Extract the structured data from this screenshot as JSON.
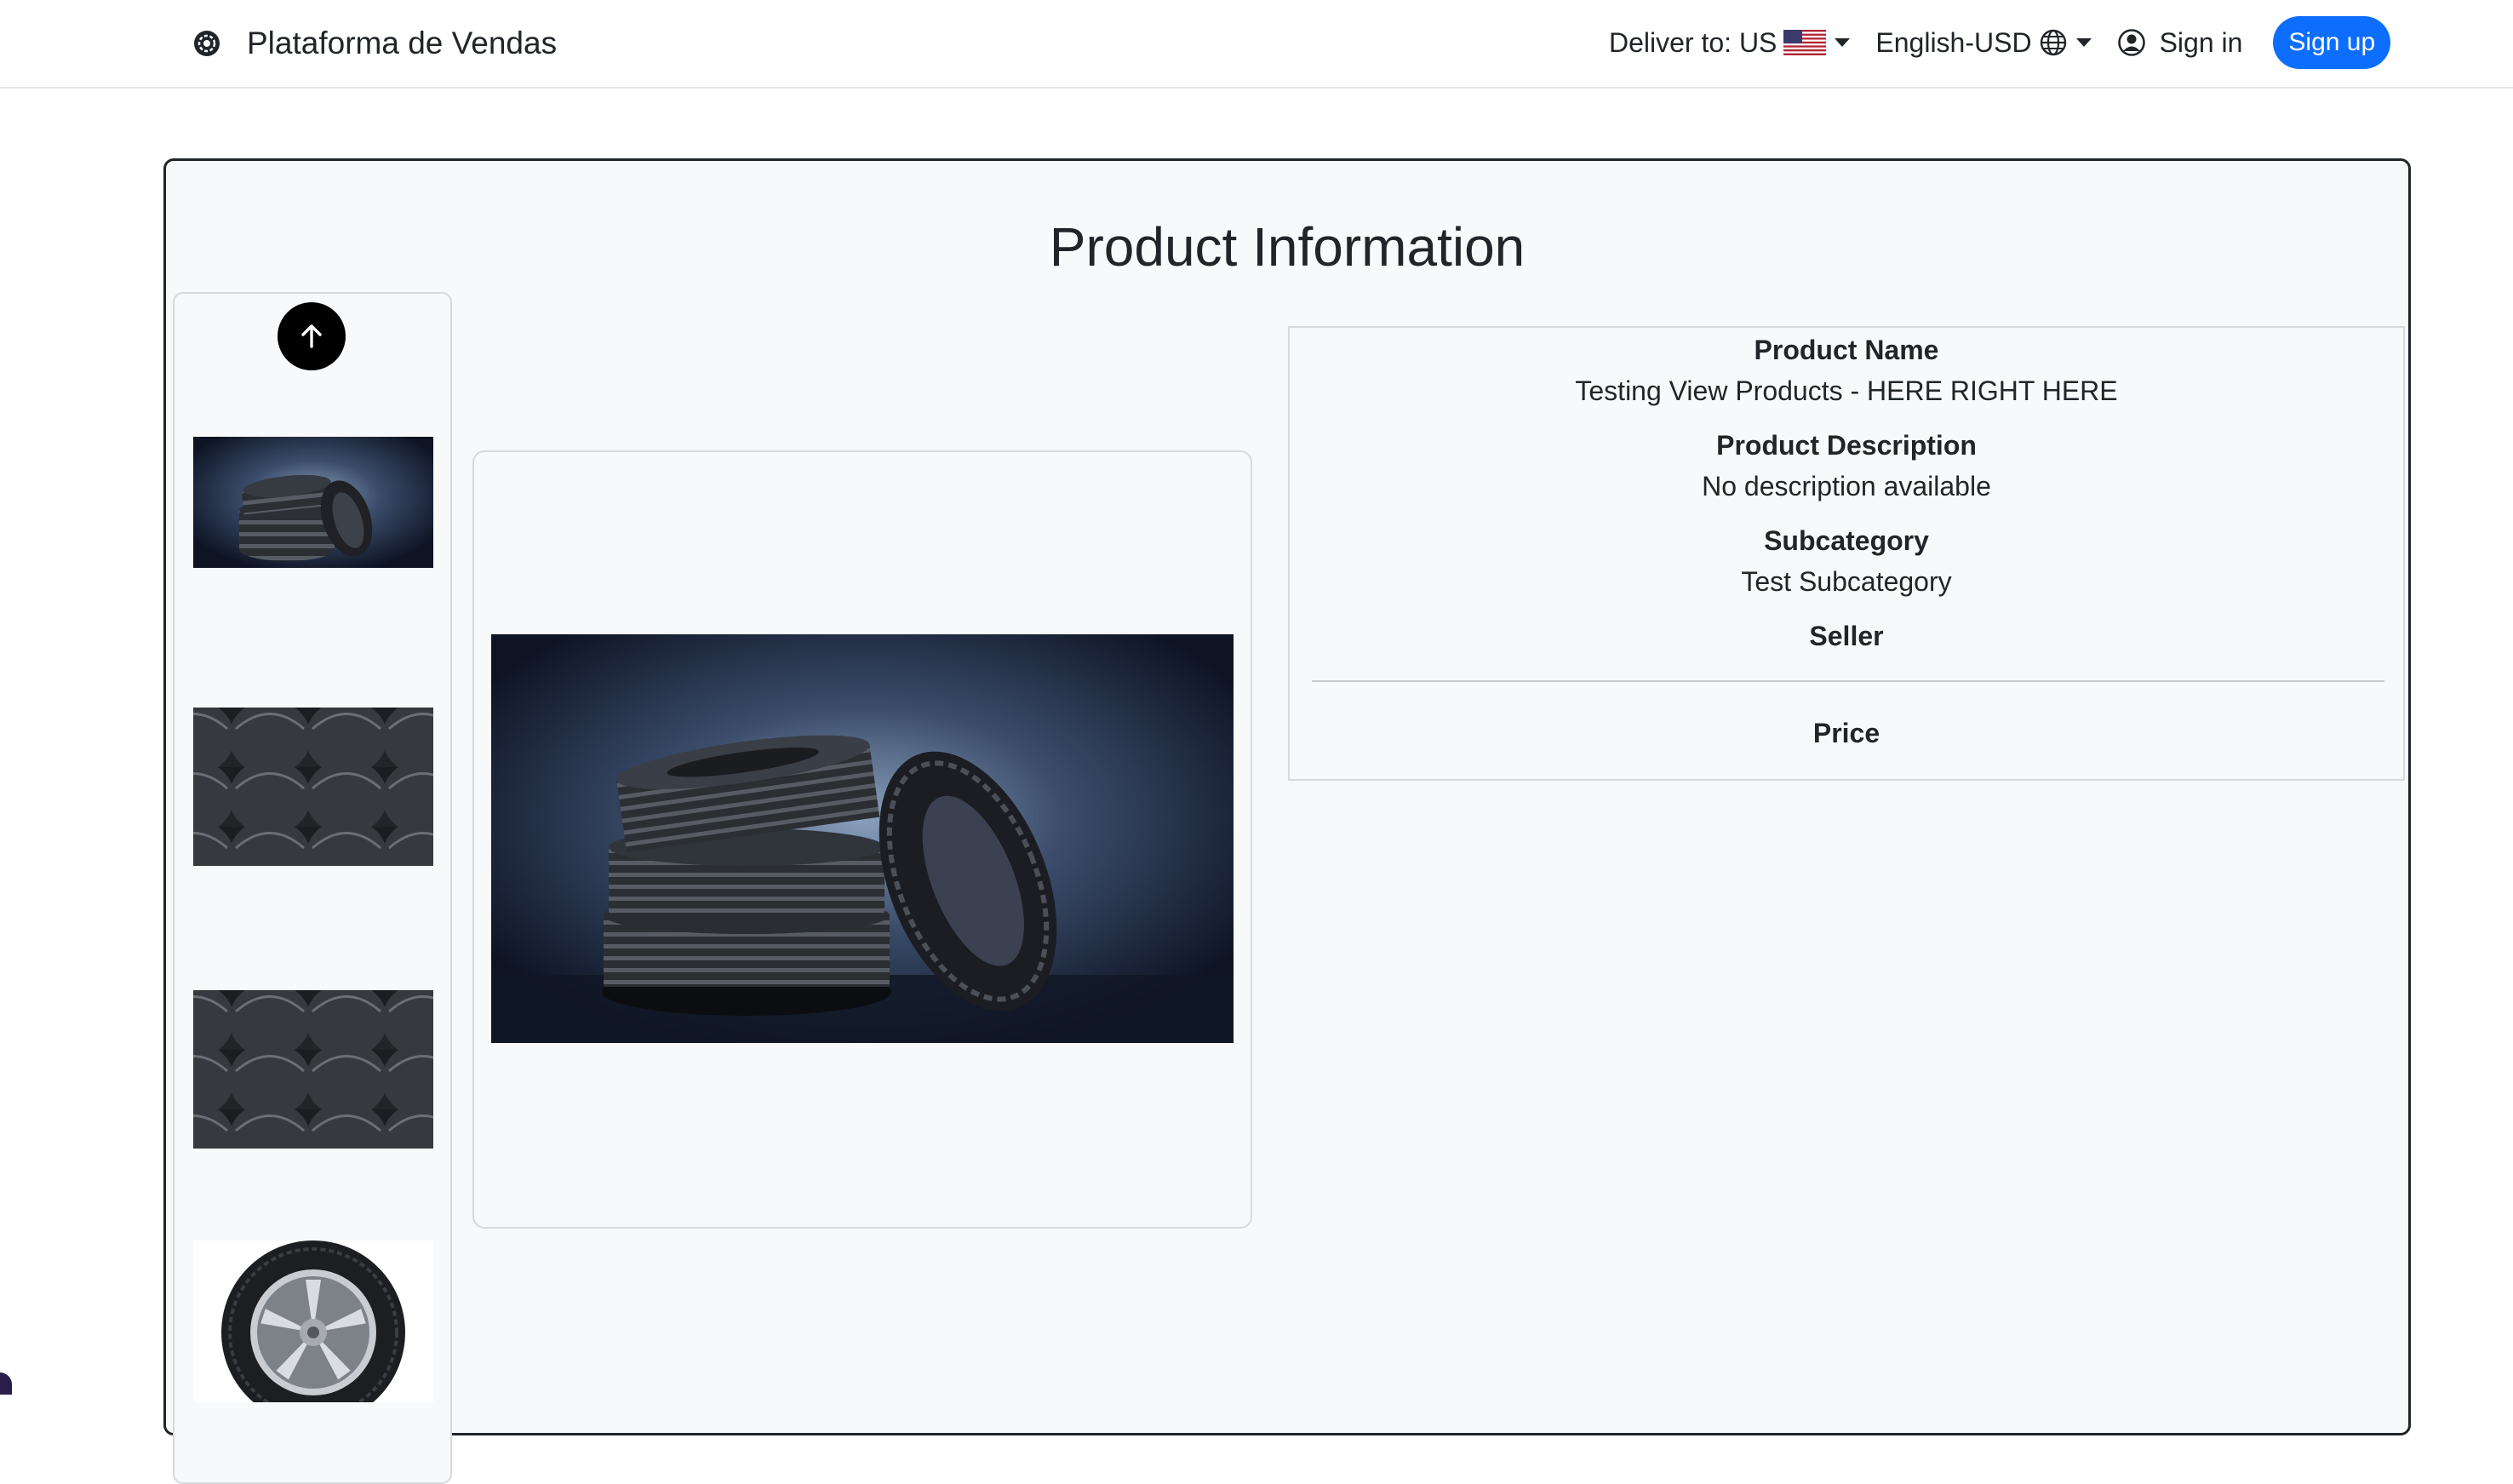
{
  "navbar": {
    "brand": "Plataforma de Vendas",
    "brand_icon": "gear-logo-icon",
    "deliver_label": "Deliver to: US",
    "flag_icon": "us-flag-icon",
    "language_label": "English-USD",
    "language_icon": "globe-icon",
    "signin_label": "Sign in",
    "signin_icon": "user-circle-icon",
    "signup_label": "Sign up",
    "accent_color": "#0d6efd"
  },
  "page": {
    "title": "Product Information"
  },
  "gallery": {
    "scroll_up_icon": "arrow-up-icon",
    "thumbnails": [
      {
        "name": "tire-stack-thumbnail"
      },
      {
        "name": "tire-pile-thumbnail"
      },
      {
        "name": "tire-pile-thumbnail"
      },
      {
        "name": "wheel-rim-thumbnail"
      }
    ],
    "main_image": "tire-stack-main-image"
  },
  "product": {
    "name_label": "Product Name",
    "name_value": "Testing View Products - HERE RIGHT HERE",
    "description_label": "Product Description",
    "description_value": "No description available",
    "subcategory_label": "Subcategory",
    "subcategory_value": "Test Subcategory",
    "seller_label": "Seller",
    "price_label": "Price"
  }
}
